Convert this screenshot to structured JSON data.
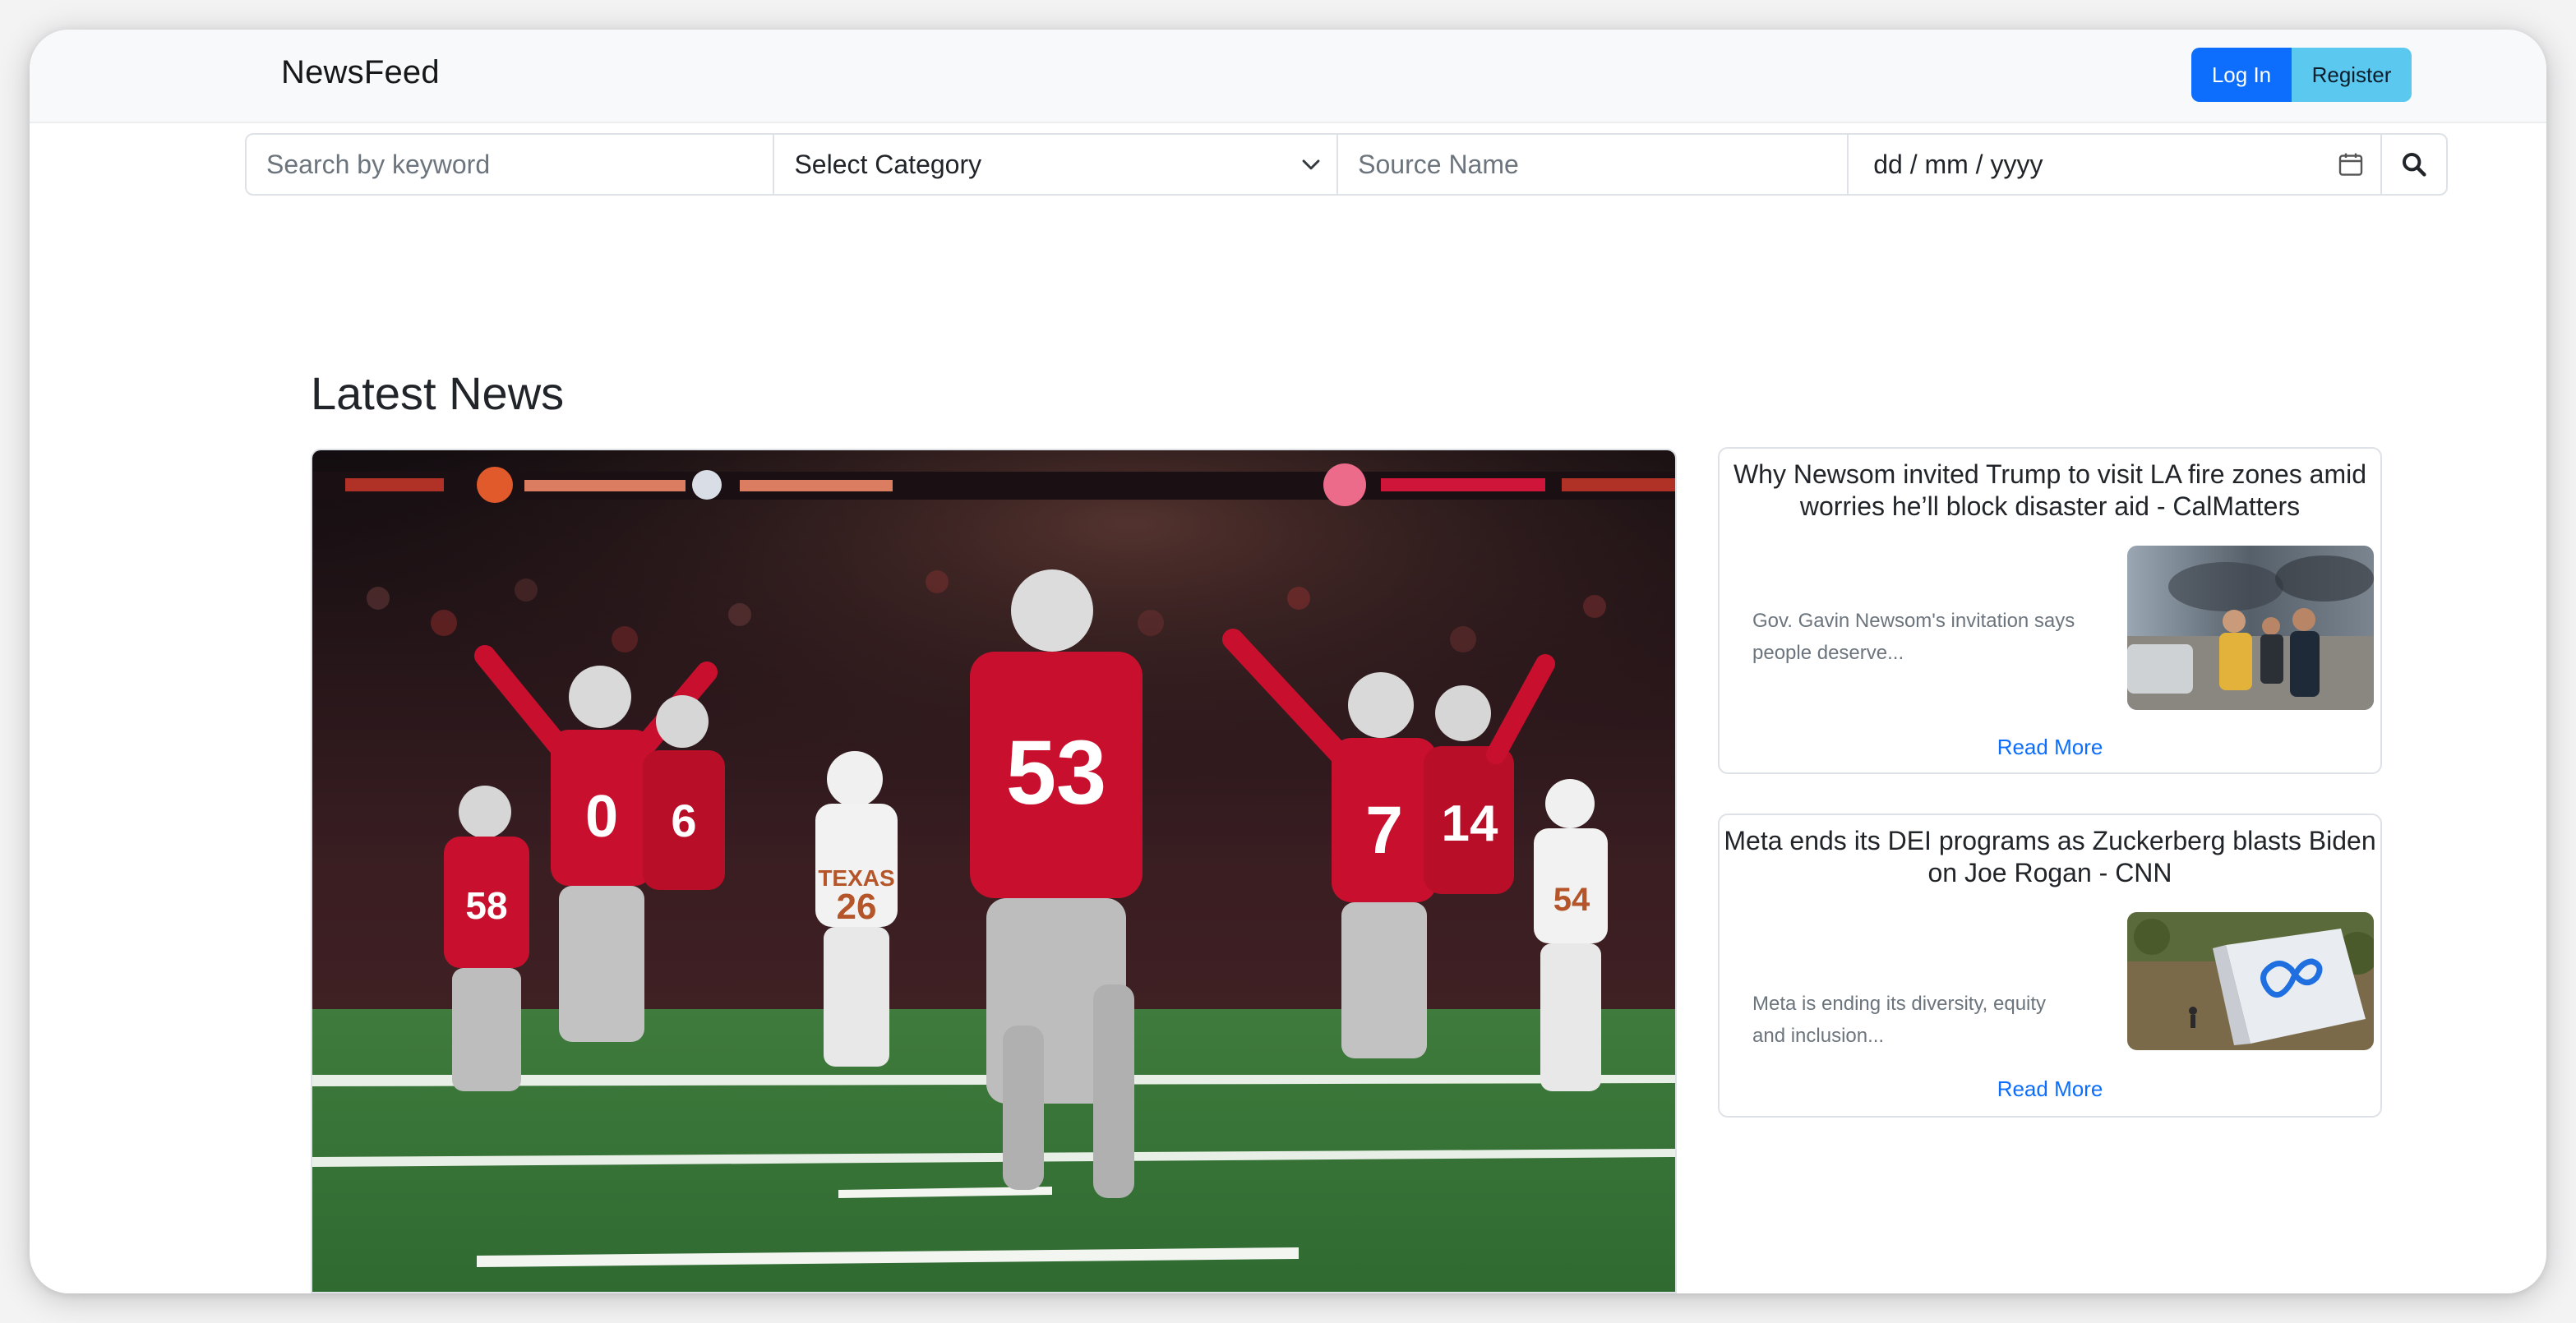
{
  "navbar": {
    "brand": "NewsFeed",
    "login_label": "Log In",
    "register_label": "Register"
  },
  "search": {
    "keyword_placeholder": "Search by keyword",
    "category_selected": "Select Category",
    "source_placeholder": "Source Name",
    "date_placeholder": "dd / mm / yyyy"
  },
  "icons": {
    "category": "chevron-down-icon",
    "date": "calendar-icon",
    "search": "search-icon"
  },
  "colors": {
    "primary": "#0d6efd",
    "info": "#5bc8ef",
    "jersey_red": "#c8102e"
  },
  "main": {
    "heading": "Latest News",
    "hero": {
      "jersey_numbers": [
        "0",
        "6",
        "53",
        "7",
        "14",
        "58",
        "26",
        "54"
      ],
      "opponent_jersey_text": "TEXAS"
    },
    "articles": [
      {
        "title": "Why Newsom invited Trump to visit LA fire zones amid worries he’ll block disaster aid - CalMatters",
        "description": "Gov. Gavin Newsom's invitation says people deserve...",
        "read_more": "Read More"
      },
      {
        "title": "Meta ends its DEI programs as Zuckerberg blasts Biden on Joe Rogan - CNN",
        "description": "Meta is ending its diversity, equity and inclusion...",
        "read_more": "Read More"
      }
    ]
  }
}
